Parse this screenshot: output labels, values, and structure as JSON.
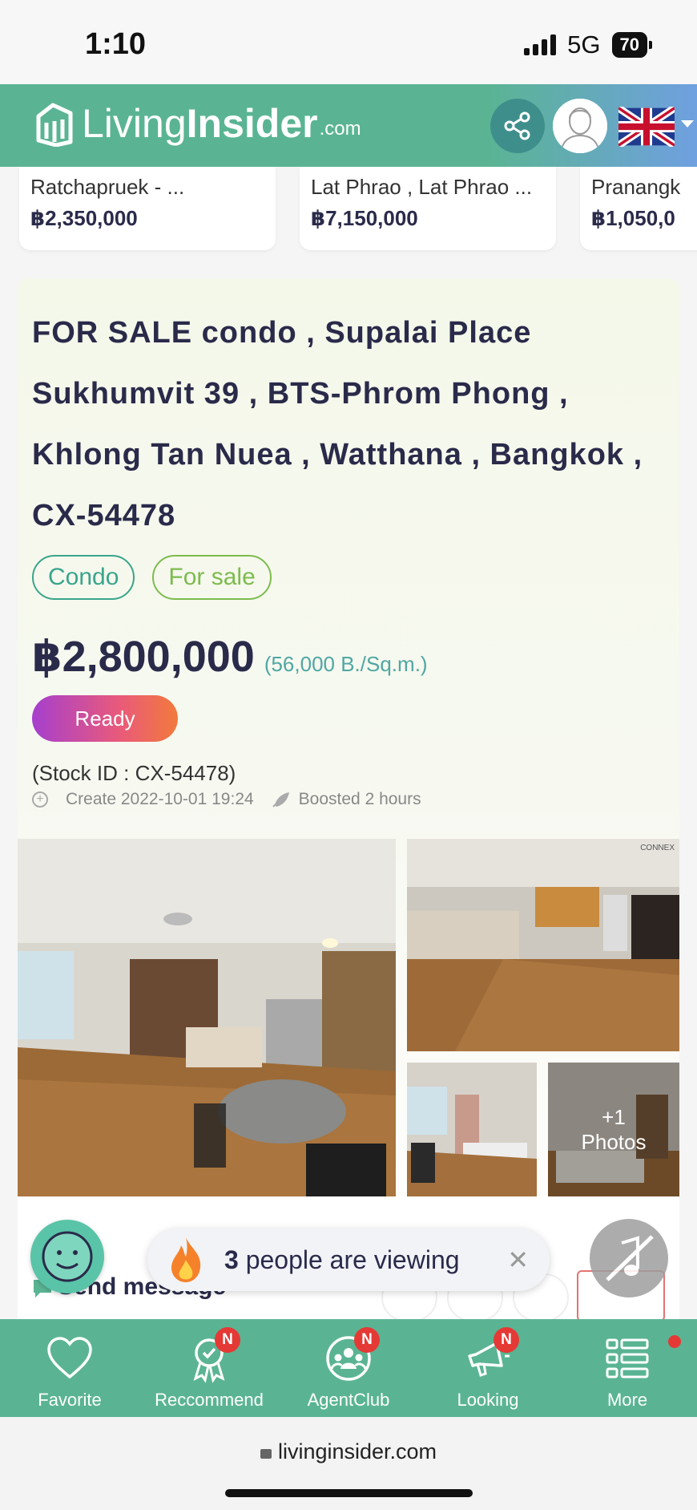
{
  "status_bar": {
    "time": "1:10",
    "network": "5G",
    "battery": "70"
  },
  "header": {
    "logo_living": "Living",
    "logo_insider": "Insider",
    "logo_com": ".com"
  },
  "recommended": [
    {
      "location": "Ratchapruek - ...",
      "price": "฿2,350,000"
    },
    {
      "location": "Lat Phrao , Lat Phrao ...",
      "price": "฿7,150,000"
    },
    {
      "location": "Pranangk",
      "price": "฿1,050,0"
    }
  ],
  "listing": {
    "title": "FOR SALE condo , Supalai Place Sukhumvit 39 , BTS-Phrom Phong , Khlong Tan Nuea , Watthana , Bangkok , CX-54478",
    "tags": [
      "Condo",
      "For sale"
    ],
    "price": "฿2,800,000",
    "price_per_sqm": "(56,000 B./Sq.m.)",
    "status": "Ready",
    "stock_id": "(Stock ID : CX-54478)",
    "created": "Create 2022-10-01 19:24",
    "boosted": "Boosted 2 hours",
    "photos_more_count": "+1",
    "photos_more_label": "Photos",
    "watermark": "CONNEX"
  },
  "send_message": {
    "label": "Send message"
  },
  "viewing_toast": {
    "count": "3",
    "text": "people are viewing",
    "close": "✕"
  },
  "bottom_nav": [
    {
      "label": "Favorite",
      "badge": ""
    },
    {
      "label": "Reccommend",
      "badge": "N"
    },
    {
      "label": "AgentClub",
      "badge": "N"
    },
    {
      "label": "Looking",
      "badge": "N"
    },
    {
      "label": "More",
      "badge": ""
    }
  ],
  "browser": {
    "url": "livinginsider.com"
  },
  "colors": {
    "brand_green": "#5ab493",
    "title_navy": "#2a2a4a",
    "badge_red": "#e53935",
    "tag_teal": "#3aa58c",
    "tag_green": "#7dbb4e"
  }
}
